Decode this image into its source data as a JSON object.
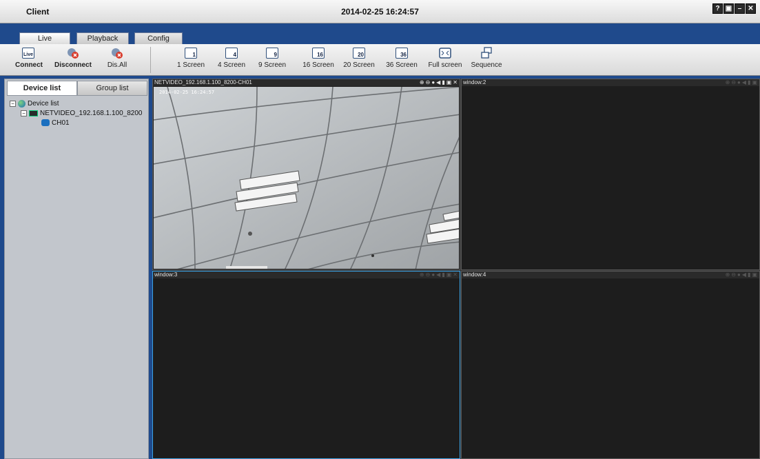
{
  "window": {
    "title": "Client",
    "datetime": "2014-02-25 16:24:57",
    "buttons": [
      "?",
      "▣",
      "–",
      "✕"
    ]
  },
  "tabs": [
    {
      "label": "Live",
      "active": true
    },
    {
      "label": "Playback",
      "active": false
    },
    {
      "label": "Config",
      "active": false
    }
  ],
  "toolbar": {
    "connect": "Connect",
    "disconnect": "Disconnect",
    "disconnect_all": "Dis.All",
    "screen1": "1 Screen",
    "screen4": "4 Screen",
    "screen9": "9 Screen",
    "screen16": "16 Screen",
    "screen20": "20 Screen",
    "screen36": "36 Screen",
    "fullscreen": "Full screen",
    "sequence": "Sequence",
    "icon_numbers": {
      "s1": "1",
      "s4": "4",
      "s9": "9",
      "s16": "16",
      "s20": "20",
      "s36": "36"
    },
    "live_icon_text": "Live"
  },
  "left_panel": {
    "tab_device": "Device list",
    "tab_group": "Group list",
    "tree": {
      "root": "Device list",
      "device": "NETVIDEO_192.168.1.100_8200",
      "channel": "CH01"
    }
  },
  "video": {
    "pane1_title": "NETVIDEO_192.168.1.100_8200-CH01",
    "pane1_osd": "2014-02-25 16:24:57",
    "pane2_title": "window:2",
    "pane3_title": "window:3",
    "pane4_title": "window:4"
  },
  "colors": {
    "brand_blue": "#1f4a8c",
    "selected_border": "#3aa3e6",
    "video_bg": "#1d1d1d"
  }
}
